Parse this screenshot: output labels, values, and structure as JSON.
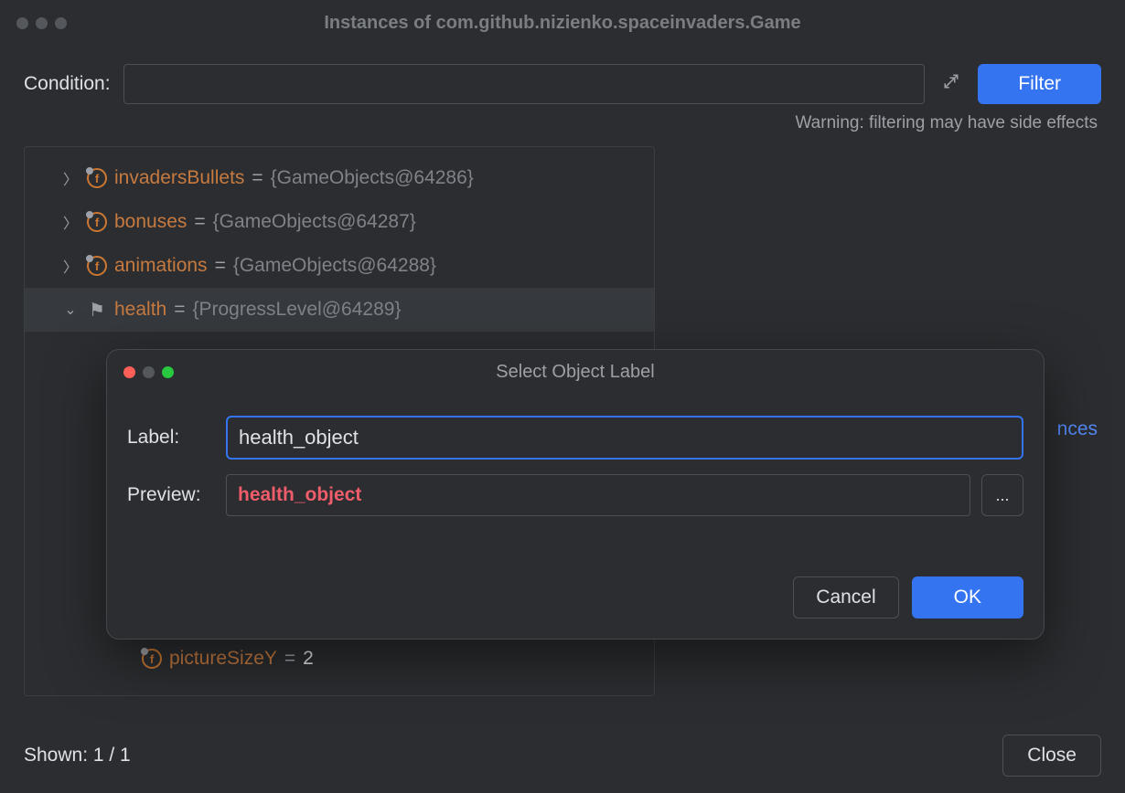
{
  "window": {
    "title": "Instances of com.github.nizienko.spaceinvaders.Game"
  },
  "condition": {
    "label": "Condition:",
    "value": "",
    "warning": "Warning: filtering may have side effects",
    "filter_label": "Filter"
  },
  "tree": [
    {
      "expand": "right",
      "icon": "f",
      "name": "invadersBullets",
      "value": "{GameObjects@64286}"
    },
    {
      "expand": "right",
      "icon": "f",
      "name": "bonuses",
      "value": "{GameObjects@64287}"
    },
    {
      "expand": "right",
      "icon": "f",
      "name": "animations",
      "value": "{GameObjects@64288}"
    },
    {
      "expand": "down",
      "icon": "flag",
      "name": "health",
      "value": "{ProgressLevel@64289}",
      "selected": true
    }
  ],
  "hidden_row": {
    "name": "pictureSizeY",
    "equals": "=",
    "value": "2"
  },
  "link_partial": "nces",
  "shown": "Shown: 1 / 1",
  "close_label": "Close",
  "modal": {
    "title": "Select Object Label",
    "label_field_label": "Label:",
    "label_value": "health_object",
    "preview_label": "Preview:",
    "preview_value": "health_object",
    "more_label": "...",
    "cancel_label": "Cancel",
    "ok_label": "OK"
  }
}
